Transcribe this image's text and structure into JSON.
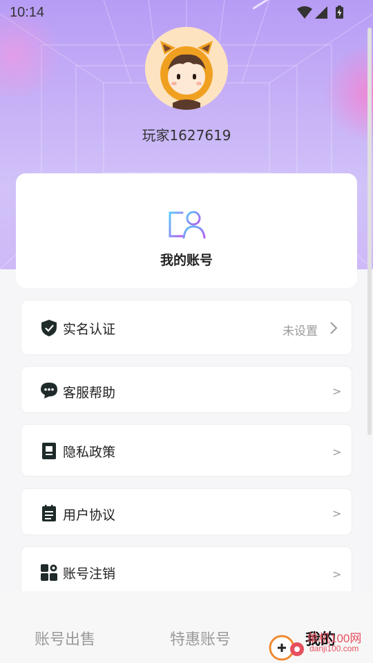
{
  "status_bar": {
    "time": "10:14",
    "icons": [
      "wifi-icon",
      "signal-icon",
      "battery-icon"
    ]
  },
  "profile": {
    "username": "玩家1627619",
    "avatar_icon": "fox-hood-avatar"
  },
  "account_card": {
    "label": "我的账号",
    "icon": "account-profile-icon"
  },
  "menu": [
    {
      "label": "实名认证",
      "value": "未设置",
      "arrow": "›",
      "icon": "shield-check-icon"
    },
    {
      "label": "客服帮助",
      "value": "",
      "arrow": ">",
      "icon": "chat-bubble-icon"
    },
    {
      "label": "隐私政策",
      "value": "",
      "arrow": ">",
      "icon": "privacy-book-icon"
    },
    {
      "label": "用户协议",
      "value": "",
      "arrow": ">",
      "icon": "agreement-clipboard-icon"
    },
    {
      "label": "账号注销",
      "value": "",
      "arrow": ">",
      "icon": "grid-settings-icon"
    }
  ],
  "tabs": [
    {
      "label": "账号出售",
      "active": false
    },
    {
      "label": "特惠账号",
      "active": false
    },
    {
      "label": "我的",
      "active": true
    }
  ],
  "watermark": {
    "line1": "单机100网",
    "line2": "danji100.com"
  },
  "colors": {
    "accent": "#b79cf5",
    "watermark": "#e6505e",
    "icon_dark": "#1f2a2a"
  }
}
